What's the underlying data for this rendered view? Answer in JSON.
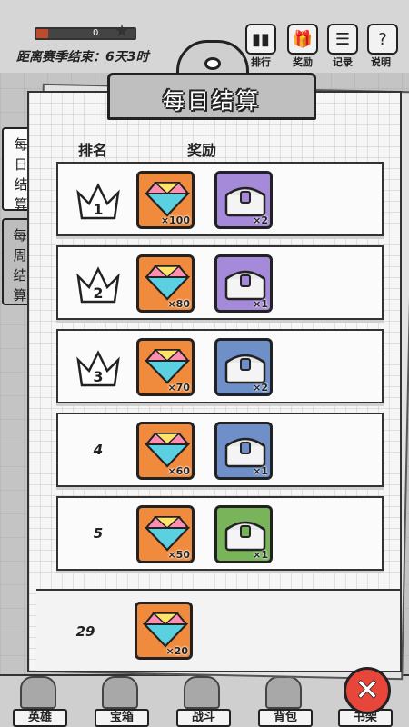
{
  "progress": {
    "value_text": "0",
    "fill_fraction": 0.12
  },
  "season": {
    "text": "距离赛季结束：6天3时"
  },
  "top_buttons": [
    {
      "label": "排行",
      "icon": "bar-chart-icon"
    },
    {
      "label": "奖励",
      "icon": "gift-icon"
    },
    {
      "label": "记录",
      "icon": "clipboard-icon"
    },
    {
      "label": "说明",
      "icon": "question-icon"
    }
  ],
  "tabs": [
    {
      "label": "每日结算",
      "active": true
    },
    {
      "label": "每周结算",
      "active": false
    }
  ],
  "header": {
    "title": "每日结算",
    "col_rank": "排名",
    "col_reward": "奖励"
  },
  "rows": [
    {
      "rank": "1",
      "crown": true,
      "gem_qty": "×100",
      "chest_color": "purple",
      "chest_qty": "×2"
    },
    {
      "rank": "2",
      "crown": true,
      "gem_qty": "×80",
      "chest_color": "purple",
      "chest_qty": "×1"
    },
    {
      "rank": "3",
      "crown": true,
      "gem_qty": "×70",
      "chest_color": "blue",
      "chest_qty": "×2"
    },
    {
      "rank": "4",
      "crown": false,
      "gem_qty": "×60",
      "chest_color": "blue",
      "chest_qty": "×1"
    },
    {
      "rank": "5",
      "crown": false,
      "gem_qty": "×50",
      "chest_color": "green",
      "chest_qty": "×1"
    }
  ],
  "my_row": {
    "rank": "29",
    "gem_qty": "×20"
  },
  "bottom_nav": [
    {
      "label": "英雄"
    },
    {
      "label": "宝箱"
    },
    {
      "label": "战斗"
    },
    {
      "label": "背包"
    },
    {
      "label": "书架"
    }
  ],
  "colors": {
    "gem_bg": "#f08a3c",
    "purple_chest": "#a58ad9",
    "blue_chest": "#6f8fc8",
    "green_chest": "#79b45a",
    "close": "#e8463a"
  }
}
